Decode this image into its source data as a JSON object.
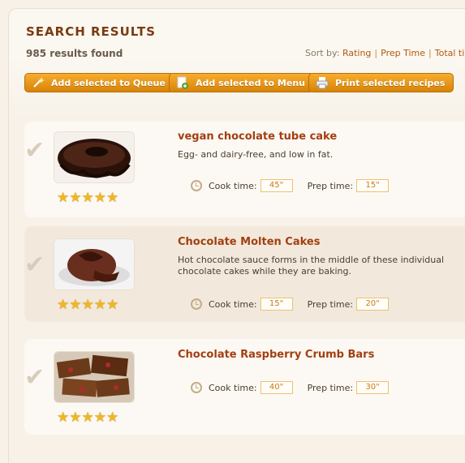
{
  "header": {
    "title": "SEARCH RESULTS",
    "count": "985 results found",
    "sort_label": "Sort by:",
    "sort_options": [
      "Rating",
      "Prep Time",
      "Total tim"
    ]
  },
  "actions": {
    "queue": "Add selected to Queue",
    "menu": "Add selected to Menu",
    "print": "Print selected recipes"
  },
  "recipes": [
    {
      "name": "vegan chocolate tube cake",
      "description": "Egg- and dairy-free, and low in fat.",
      "cook_label": "Cook time:",
      "cook": "45\"",
      "prep_label": "Prep time:",
      "prep": "15\"",
      "stars": "★★★★★"
    },
    {
      "name": "Chocolate Molten Cakes",
      "description": "Hot chocolate sauce forms in the middle of these individual chocolate cakes while they are baking.",
      "cook_label": "Cook time:",
      "cook": "15\"",
      "prep_label": "Prep time:",
      "prep": "20\"",
      "stars": "★★★★★"
    },
    {
      "name": "Chocolate Raspberry Crumb Bars",
      "description": "",
      "cook_label": "Cook time:",
      "cook": "40\"",
      "prep_label": "Prep time:",
      "prep": "30\"",
      "stars": "★★★★★"
    }
  ],
  "colors": {
    "accent": "#a33f10",
    "button": "#e89a1a",
    "star": "#f2b624"
  },
  "icons": [
    "checkmark-icon",
    "clock-icon",
    "wand-icon",
    "menu-add-icon",
    "printer-icon",
    "star-icon"
  ]
}
